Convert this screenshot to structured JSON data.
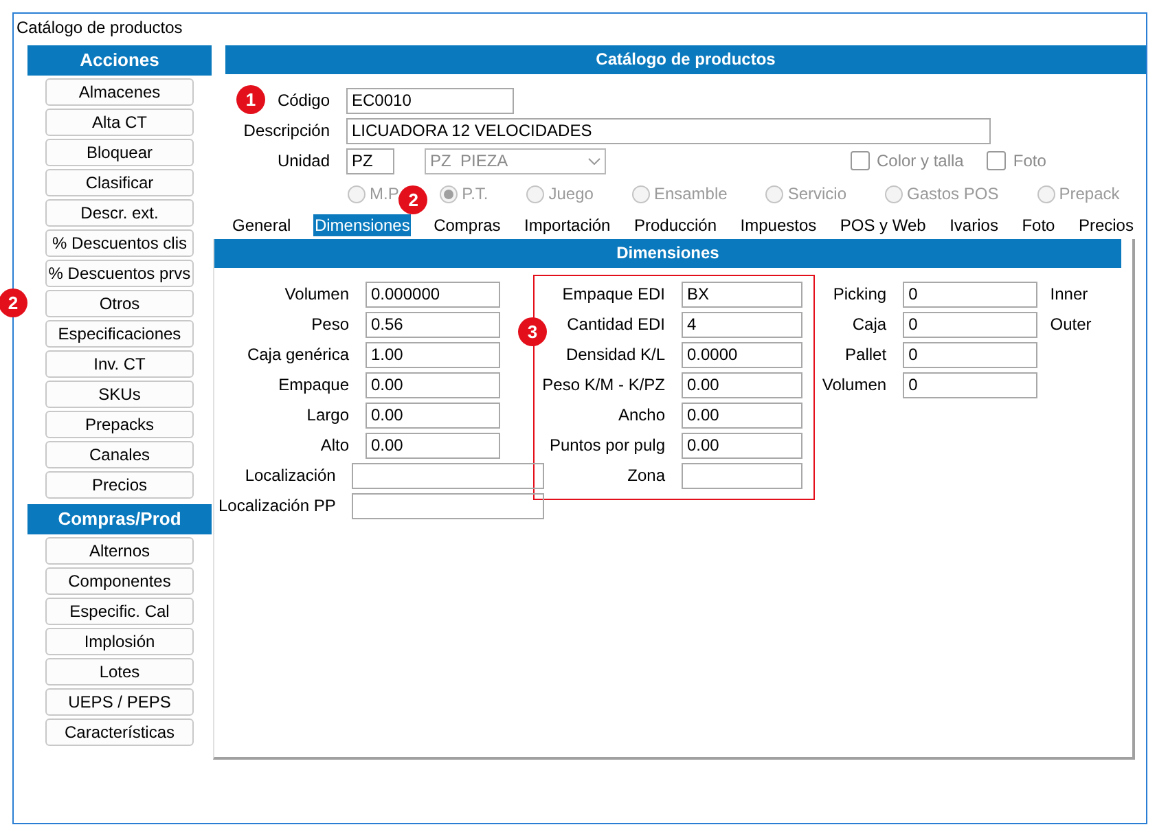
{
  "window": {
    "title": "Catálogo de productos"
  },
  "sidebar": {
    "sections": [
      {
        "title": "Acciones",
        "buttons": [
          {
            "label": "Almacenes"
          },
          {
            "label": "Alta CT"
          },
          {
            "label": "Bloquear"
          },
          {
            "label": "Clasificar"
          },
          {
            "label": "Descr. ext."
          },
          {
            "label": "% Descuentos clis"
          },
          {
            "label": "% Descuentos prvs"
          },
          {
            "label": "Otros",
            "callout": "2"
          },
          {
            "label": "Especificaciones"
          },
          {
            "label": "Inv. CT"
          },
          {
            "label": "SKUs"
          },
          {
            "label": "Prepacks"
          },
          {
            "label": "Canales"
          },
          {
            "label": "Precios"
          }
        ]
      },
      {
        "title": "Compras/Prod",
        "buttons": [
          {
            "label": "Alternos"
          },
          {
            "label": "Componentes"
          },
          {
            "label": "Especific. Cal"
          },
          {
            "label": "Implosión"
          },
          {
            "label": "Lotes"
          },
          {
            "label": "UEPS / PEPS"
          },
          {
            "label": "Características"
          }
        ]
      }
    ]
  },
  "main": {
    "title": "Catálogo de productos",
    "code": {
      "label": "Código",
      "value": "EC0010",
      "callout": "1"
    },
    "description": {
      "label": "Descripción",
      "value": "LICUADORA 12 VELOCIDADES"
    },
    "unit": {
      "label": "Unidad",
      "value": "PZ",
      "select": "PZ  PIEZA",
      "select_disabled": true
    },
    "checkboxes": [
      {
        "label": "Color y talla",
        "checked": false
      },
      {
        "label": "Foto",
        "checked": false
      }
    ],
    "product_types": [
      {
        "label": "M.P.",
        "selected": false,
        "disabled": true
      },
      {
        "label": "P.T.",
        "selected": true,
        "disabled": true
      },
      {
        "label": "Juego",
        "selected": false,
        "disabled": true
      },
      {
        "label": "Ensamble",
        "selected": false,
        "disabled": true
      },
      {
        "label": "Servicio",
        "selected": false,
        "disabled": true
      },
      {
        "label": "Gastos POS",
        "selected": false,
        "disabled": true
      },
      {
        "label": "Prepack",
        "selected": false,
        "disabled": true
      }
    ],
    "tabs": [
      {
        "label": "General",
        "selected": false
      },
      {
        "label": "Dimensiones",
        "selected": true,
        "callout": "2"
      },
      {
        "label": "Compras",
        "selected": false
      },
      {
        "label": "Importación",
        "selected": false
      },
      {
        "label": "Producción",
        "selected": false
      },
      {
        "label": "Impuestos",
        "selected": false
      },
      {
        "label": "POS y Web",
        "selected": false
      },
      {
        "label": "Ivarios",
        "selected": false
      },
      {
        "label": "Foto",
        "selected": false
      },
      {
        "label": "Precios",
        "selected": false
      }
    ],
    "panel": {
      "title": "Dimensiones",
      "columns": [
        {
          "highlighted": false,
          "fields": [
            {
              "kind": "field",
              "label": "Volumen",
              "value": "0.000000"
            },
            {
              "kind": "field",
              "label": "Peso",
              "value": "0.56"
            },
            {
              "kind": "field",
              "label": "Caja genérica",
              "value": "1.00"
            },
            {
              "kind": "field",
              "label": "Empaque",
              "value": "0.00"
            },
            {
              "kind": "field",
              "label": "Largo",
              "value": "0.00"
            },
            {
              "kind": "field",
              "label": "Alto",
              "value": "0.00"
            },
            {
              "kind": "wide",
              "label": "Localización"
            },
            {
              "kind": "wide",
              "label": "Localización PP"
            }
          ]
        },
        {
          "highlighted": true,
          "callout": "3",
          "fields": [
            {
              "kind": "field",
              "label": "Empaque EDI",
              "value": "BX"
            },
            {
              "kind": "field",
              "label": "Cantidad EDI",
              "value": "4"
            },
            {
              "kind": "field",
              "label": "Densidad K/L",
              "value": "0.0000"
            },
            {
              "kind": "field",
              "label": "Peso K/M - K/PZ",
              "value": "0.00"
            },
            {
              "kind": "field",
              "label": "Ancho",
              "value": "0.00"
            },
            {
              "kind": "field",
              "label": "Puntos por pulg",
              "value": "0.00"
            },
            {
              "kind": "field",
              "label": "Zona"
            }
          ]
        },
        {
          "highlighted": false,
          "fields": [
            {
              "kind": "field",
              "label": "Picking",
              "value": "0"
            },
            {
              "kind": "field",
              "label": "Caja",
              "value": "0"
            },
            {
              "kind": "field",
              "label": "Pallet",
              "value": "0"
            },
            {
              "kind": "field",
              "label": "Volumen",
              "value": "0"
            }
          ]
        },
        {
          "highlighted": false,
          "fields": [
            {
              "kind": "note",
              "label": "Inner"
            },
            {
              "kind": "note",
              "label": "Outer"
            }
          ]
        }
      ]
    }
  }
}
